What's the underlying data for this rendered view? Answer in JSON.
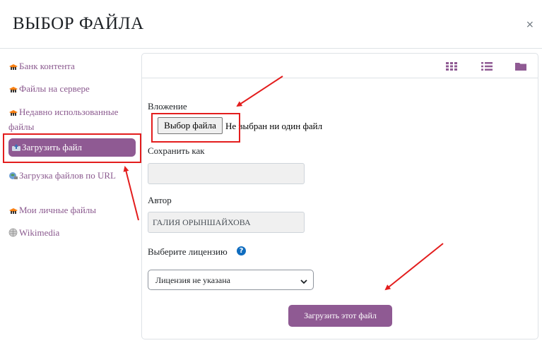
{
  "dialog": {
    "title": "ВЫБОР ФАЙЛА",
    "close": "×"
  },
  "sidebar": {
    "items": [
      {
        "label": "Банк контента",
        "icon": "moodle-hat-icon",
        "active": false
      },
      {
        "label": "Файлы на сервере",
        "icon": "moodle-hat-icon",
        "active": false
      },
      {
        "label": "Недавно использованные файлы",
        "icon": "moodle-hat-icon",
        "active": false
      },
      {
        "label": "Загрузить файл",
        "icon": "upload-icon",
        "active": true
      },
      {
        "label": "Загрузка файлов по URL",
        "icon": "url-download-icon",
        "active": false
      },
      {
        "label": "Мои личные файлы",
        "icon": "moodle-hat-icon",
        "active": false
      },
      {
        "label": "Wikimedia",
        "icon": "wikimedia-globe-icon",
        "active": false
      }
    ]
  },
  "toolbar": {
    "views": [
      "grid-view-icon",
      "list-view-icon",
      "folder-view-icon"
    ]
  },
  "form": {
    "attachment_label": "Вложение",
    "choose_button": "Выбор файла",
    "no_file_text": "Не выбран ни один файл",
    "save_as_label": "Сохранить как",
    "save_as_value": "",
    "author_label": "Автор",
    "author_value": "ГАЛИЯ ОРЫНШАЙХОВА",
    "license_label": "Выберите лицензию",
    "license_value": "Лицензия не указана",
    "submit_button": "Загрузить этот файл"
  },
  "colors": {
    "accent": "#8f5a93",
    "annotation": "#e31d1d",
    "help": "#0f6cbf"
  }
}
